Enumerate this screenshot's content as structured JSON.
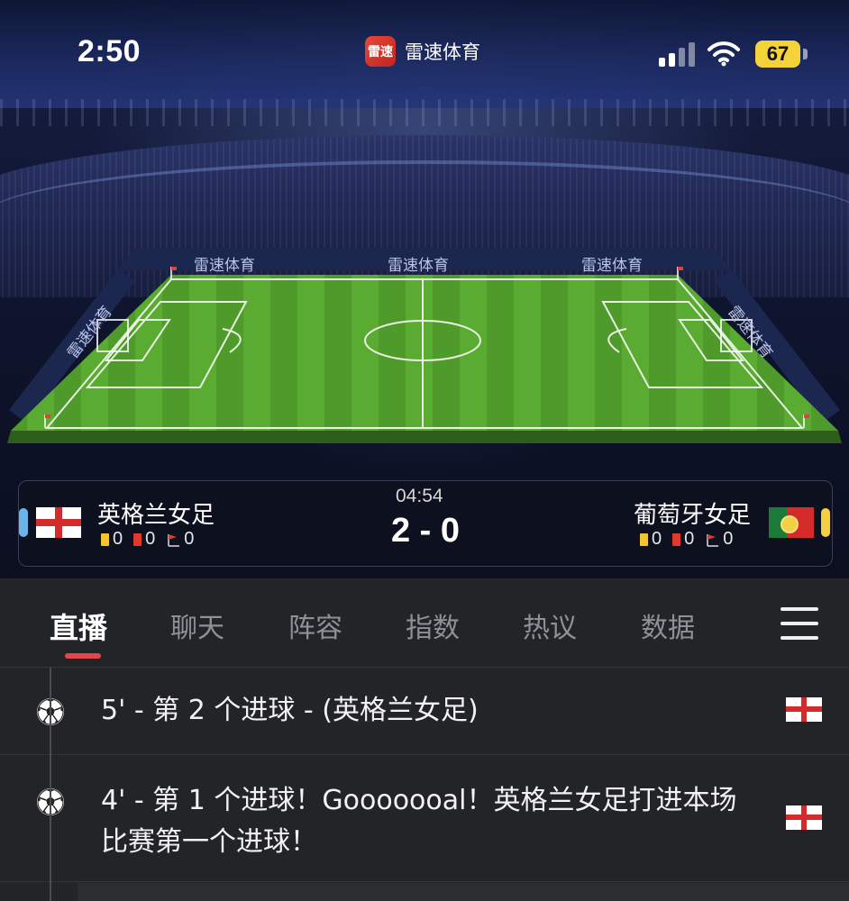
{
  "status_bar": {
    "time": "2:50",
    "battery": "67"
  },
  "app": {
    "logo_text": "雷速",
    "name": "雷速体育",
    "board_text": "雷速体育"
  },
  "match": {
    "home": {
      "name": "英格兰女足",
      "yellow": "0",
      "red": "0",
      "corners": "0"
    },
    "away": {
      "name": "葡萄牙女足",
      "yellow": "0",
      "red": "0",
      "corners": "0"
    },
    "time": "04:54",
    "score": "2 - 0"
  },
  "tabs": [
    {
      "label": "直播",
      "active": true
    },
    {
      "label": "聊天"
    },
    {
      "label": "阵容"
    },
    {
      "label": "指数"
    },
    {
      "label": "热议"
    },
    {
      "label": "数据"
    }
  ],
  "events": [
    {
      "text": "5' - 第 2 个进球 - (英格兰女足)"
    },
    {
      "text": "4' - 第 1 个进球！Gooooooal！英格兰女足打进本场比赛第一个进球！"
    }
  ],
  "colors": {
    "accent": "#e4454a",
    "home_accent": "#6ab4ea",
    "away_accent": "#f2cf43",
    "background": "#232427"
  }
}
